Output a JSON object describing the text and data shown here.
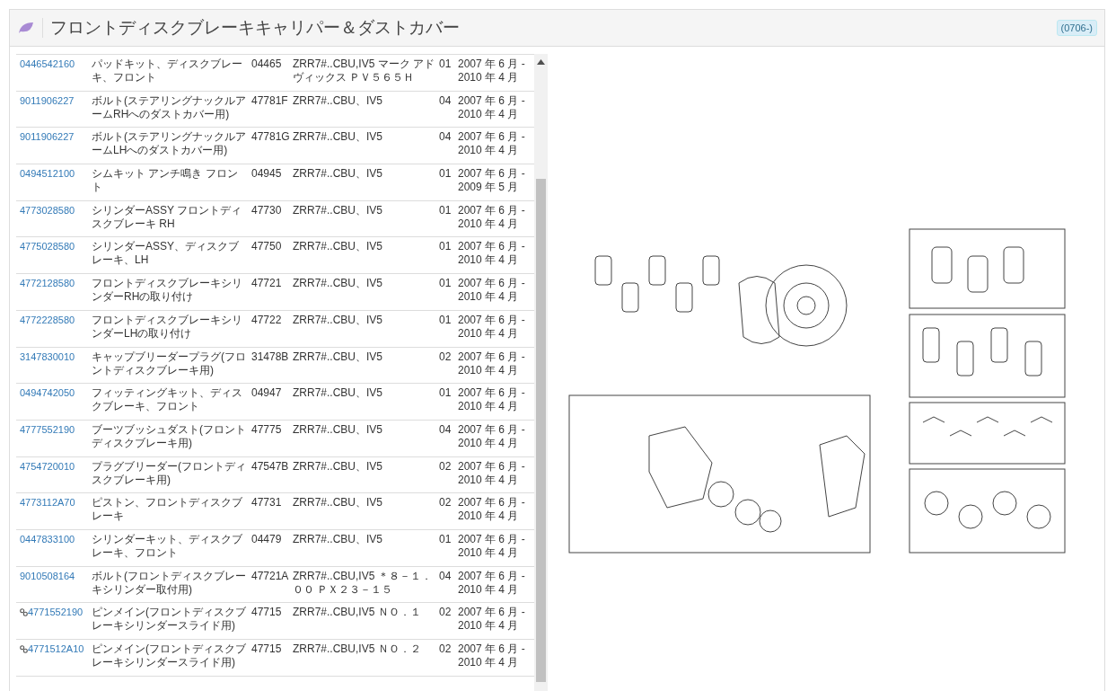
{
  "header": {
    "title": "フロントディスクブレーキキャリパー＆ダストカバー",
    "badge": "(0706-)"
  },
  "parts": [
    {
      "number": "0446542160",
      "linked": false,
      "name": "パッドキット、ディスクブレーキ、フロント",
      "code": "04465",
      "applicability": "ZRR7#..CBU,IV5 マーク アドヴィックス ＰＶ５６５Ｈ",
      "qty": "01",
      "date": "2007 年 6 月 - 2010 年 4 月"
    },
    {
      "number": "9011906227",
      "linked": false,
      "name": "ボルト(ステアリングナックルアームRHへのダストカバー用)",
      "code": "47781F",
      "applicability": "ZRR7#..CBU、IV5",
      "qty": "04",
      "date": "2007 年 6 月 - 2010 年 4 月"
    },
    {
      "number": "9011906227",
      "linked": false,
      "name": "ボルト(ステアリングナックルアームLHへのダストカバー用)",
      "code": "47781G",
      "applicability": "ZRR7#..CBU、IV5",
      "qty": "04",
      "date": "2007 年 6 月 - 2010 年 4 月"
    },
    {
      "number": "0494512100",
      "linked": false,
      "name": "シムキット アンチ鳴き フロント",
      "code": "04945",
      "applicability": "ZRR7#..CBU、IV5",
      "qty": "01",
      "date": "2007 年 6 月 - 2009 年 5 月"
    },
    {
      "number": "4773028580",
      "linked": false,
      "name": "シリンダーASSY フロントディスクブレーキ RH",
      "code": "47730",
      "applicability": "ZRR7#..CBU、IV5",
      "qty": "01",
      "date": "2007 年 6 月 - 2010 年 4 月"
    },
    {
      "number": "4775028580",
      "linked": false,
      "name": "シリンダーASSY、ディスクブレーキ、LH",
      "code": "47750",
      "applicability": "ZRR7#..CBU、IV5",
      "qty": "01",
      "date": "2007 年 6 月 - 2010 年 4 月"
    },
    {
      "number": "4772128580",
      "linked": false,
      "name": "フロントディスクブレーキシリンダーRHの取り付け",
      "code": "47721",
      "applicability": "ZRR7#..CBU、IV5",
      "qty": "01",
      "date": "2007 年 6 月 - 2010 年 4 月"
    },
    {
      "number": "4772228580",
      "linked": false,
      "name": "フロントディスクブレーキシリンダーLHの取り付け",
      "code": "47722",
      "applicability": "ZRR7#..CBU、IV5",
      "qty": "01",
      "date": "2007 年 6 月 - 2010 年 4 月"
    },
    {
      "number": "3147830010",
      "linked": false,
      "name": "キャップブリーダープラグ(フロントディスクブレーキ用)",
      "code": "31478B",
      "applicability": "ZRR7#..CBU、IV5",
      "qty": "02",
      "date": "2007 年 6 月 - 2010 年 4 月"
    },
    {
      "number": "0494742050",
      "linked": false,
      "name": "フィッティングキット、ディスクブレーキ、フロント",
      "code": "04947",
      "applicability": "ZRR7#..CBU、IV5",
      "qty": "01",
      "date": "2007 年 6 月 - 2010 年 4 月"
    },
    {
      "number": "4777552190",
      "linked": false,
      "name": "ブーツブッシュダスト(フロントディスクブレーキ用)",
      "code": "47775",
      "applicability": "ZRR7#..CBU、IV5",
      "qty": "04",
      "date": "2007 年 6 月 - 2010 年 4 月"
    },
    {
      "number": "4754720010",
      "linked": false,
      "name": "プラグブリーダー(フロントディスクブレーキ用)",
      "code": "47547B",
      "applicability": "ZRR7#..CBU、IV5",
      "qty": "02",
      "date": "2007 年 6 月 - 2010 年 4 月"
    },
    {
      "number": "4773112A70",
      "linked": false,
      "name": "ピストン、フロントディスクブレーキ",
      "code": "47731",
      "applicability": "ZRR7#..CBU、IV5",
      "qty": "02",
      "date": "2007 年 6 月 - 2010 年 4 月"
    },
    {
      "number": "0447833100",
      "linked": false,
      "name": "シリンダーキット、ディスクブレーキ、フロント",
      "code": "04479",
      "applicability": "ZRR7#..CBU、IV5",
      "qty": "01",
      "date": "2007 年 6 月 - 2010 年 4 月"
    },
    {
      "number": "9010508164",
      "linked": false,
      "name": "ボルト(フロントディスクブレーキシリンダー取付用)",
      "code": "47721A",
      "applicability": "ZRR7#..CBU,IV5 ＊８－１．００ ＰＸ２３－１５",
      "qty": "04",
      "date": "2007 年 6 月 - 2010 年 4 月"
    },
    {
      "number": "4771552190",
      "linked": true,
      "name": "ピンメイン(フロントディスクブレーキシリンダースライド用)",
      "code": "47715",
      "applicability": "ZRR7#..CBU,IV5 ＮＯ．１",
      "qty": "02",
      "date": "2007 年 6 月 - 2010 年 4 月"
    },
    {
      "number": "4771512A10",
      "linked": true,
      "name": "ピンメイン(フロントディスクブレーキシリンダースライド用)",
      "code": "47715",
      "applicability": "ZRR7#..CBU,IV5 ＮＯ．２",
      "qty": "02",
      "date": "2007 年 6 月 - 2010 年 4 月"
    }
  ]
}
